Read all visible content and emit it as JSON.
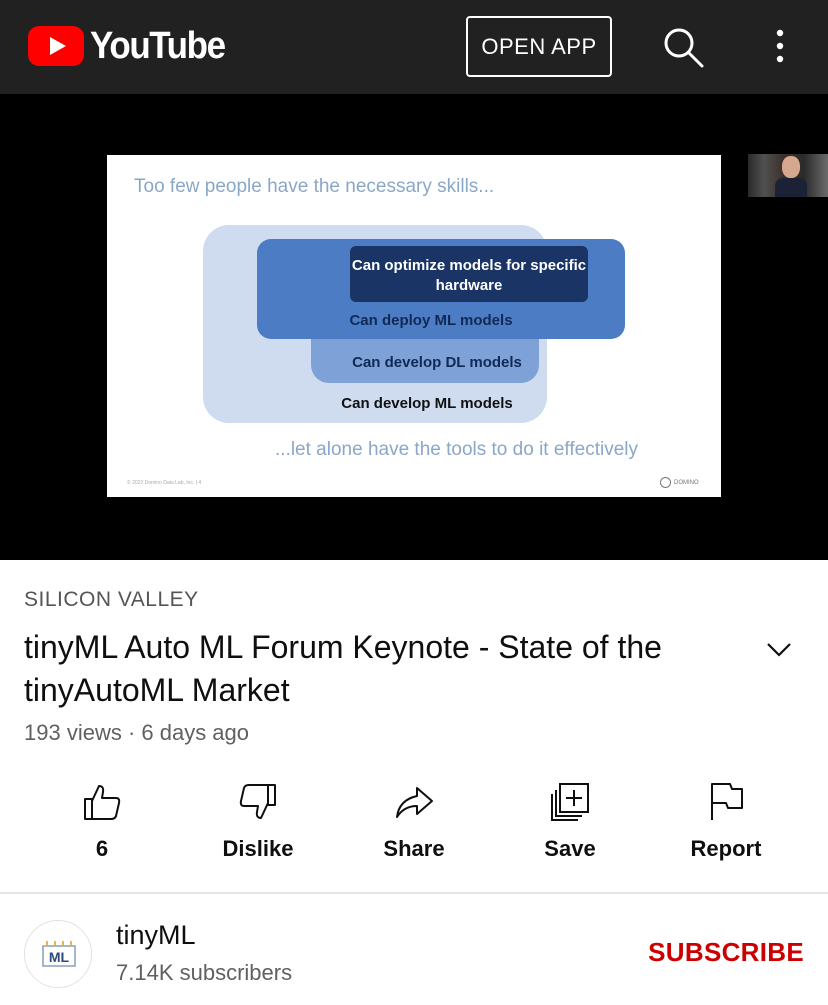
{
  "header": {
    "logo_text": "YouTube",
    "open_app_label": "OPEN APP",
    "search_icon": "search-icon",
    "more_icon": "more-vert-icon",
    "background_color": "#212121"
  },
  "video": {
    "slide": {
      "title": "Too few people have the necessary skills...",
      "boxes": [
        "Can optimize models for specific hardware",
        "Can deploy ML models",
        "Can develop DL models",
        "Can develop ML models"
      ],
      "footer": "...let alone have the tools to do it effectively",
      "copyright": "© 2022 Domino Data Lab, Inc. | 4",
      "brand": "DOMINO"
    }
  },
  "info": {
    "channel_tag": "SILICON VALLEY",
    "title": "tinyML Auto ML Forum Keynote - State of the tinyAutoML Market",
    "meta": "193 views · 6 days ago"
  },
  "actions": [
    {
      "label": "6",
      "icon": "thumbs-up-icon"
    },
    {
      "label": "Dislike",
      "icon": "thumbs-down-icon"
    },
    {
      "label": "Share",
      "icon": "share-icon"
    },
    {
      "label": "Save",
      "icon": "save-playlist-icon"
    },
    {
      "label": "Report",
      "icon": "flag-icon"
    }
  ],
  "channel": {
    "name": "tinyML",
    "subscribers": "7.14K subscribers",
    "subscribe_label": "SUBSCRIBE",
    "subscribe_color": "#cc0000",
    "avatar_text": "ML"
  }
}
